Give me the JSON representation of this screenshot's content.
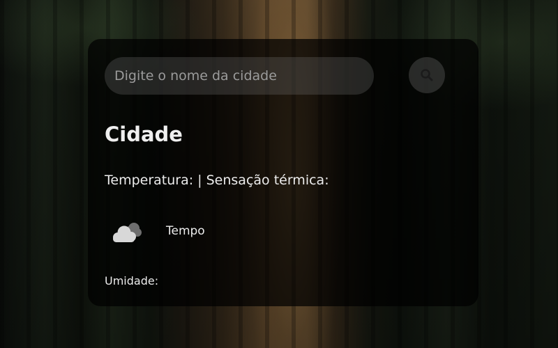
{
  "search": {
    "placeholder": "Digite o nome da cidade",
    "value": "",
    "button_icon": "search-icon"
  },
  "weather": {
    "city": "Cidade",
    "temperature_line": "Temperatura: | Sensação térmica:",
    "icon": "cloud-icon",
    "description": "Tempo",
    "humidity": "Umidade:"
  }
}
